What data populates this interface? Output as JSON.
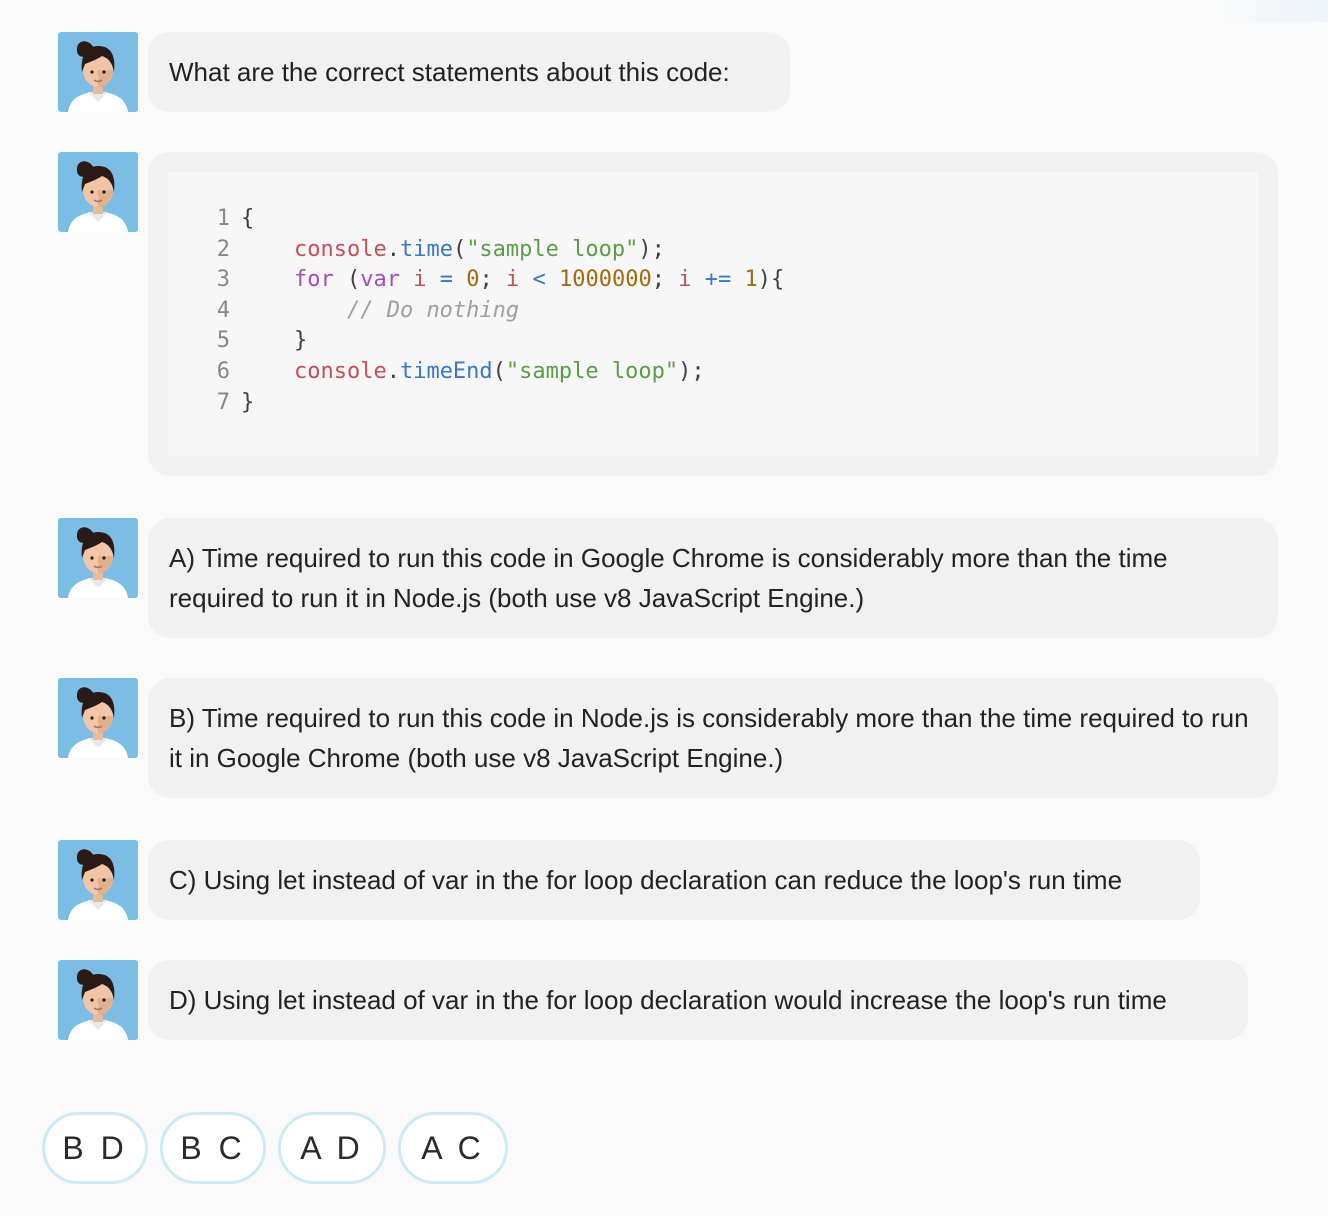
{
  "messages": [
    {
      "text": "What are the correct statements about this code:"
    },
    {
      "text": "A) Time required to run this code in Google Chrome is considerably more than the time required to run it in Node.js (both use v8 JavaScript Engine.)"
    },
    {
      "text": "B) Time required to run this code in Node.js is considerably more than the time required to run it in Google Chrome (both use v8 JavaScript Engine.)"
    },
    {
      "text": "C) Using let instead of var in the for loop declaration can reduce the loop's run time"
    },
    {
      "text": "D) Using let instead of var in the for loop declaration would increase the loop's run time"
    }
  ],
  "code": {
    "line_numbers": [
      "1",
      "2",
      "3",
      "4",
      "5",
      "6",
      "7"
    ],
    "l1": {
      "brace": "{"
    },
    "l2": {
      "obj": "console",
      "dot": ".",
      "fn": "time",
      "open": "(",
      "str": "\"sample loop\"",
      "close": ");"
    },
    "l3": {
      "kw_for": "for",
      "p1": " (",
      "kw_var": "var",
      "v1": "i",
      "op1": "=",
      "n1": "0",
      "semi1": ";",
      "v2": "i",
      "op2": "<",
      "n2": "1000000",
      "semi2": ";",
      "v3": "i",
      "op3": "+=",
      "n3": "1",
      "close": "){"
    },
    "l4": {
      "comment": "// Do nothing"
    },
    "l5": {
      "brace": "}"
    },
    "l6": {
      "obj": "console",
      "dot": ".",
      "fn": "timeEnd",
      "open": "(",
      "str": "\"sample loop\"",
      "close": ");"
    },
    "l7": {
      "brace": "}"
    }
  },
  "answers": [
    {
      "label": "B D"
    },
    {
      "label": "B C"
    },
    {
      "label": "A D"
    },
    {
      "label": "A C"
    }
  ],
  "icons": {
    "avatar": "woman-avatar-icon"
  },
  "colors": {
    "avatar_bg": "#7cbde6",
    "bubble_bg": "#f1f1f1",
    "answer_border": "#cdeaf7"
  }
}
